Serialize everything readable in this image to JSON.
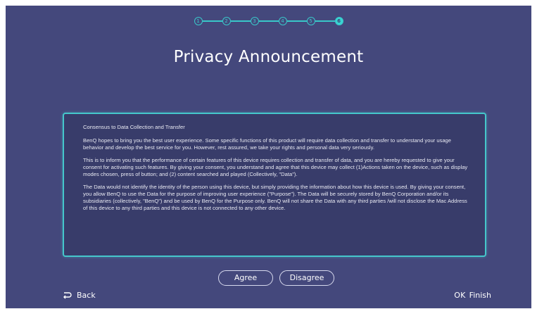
{
  "steps": [
    "1",
    "2",
    "3",
    "4",
    "5",
    "6"
  ],
  "active_step": 6,
  "title": "Privacy Announcement",
  "panel": {
    "heading": "Consensus to Data Collection and Transfer",
    "paragraphs": [
      "BenQ hopes to bring you the best user experience. Some specific functions of this product will require data collection and transfer to understand your usage behavior and develop the best service for you. However, rest assured, we take your rights and personal data very seriously.",
      "This is to inform you that the performance of certain features of this device requires collection and transfer of data, and you are hereby requested to give your consent for activating such features. By giving your consent, you understand and agree that this device may collect (1)Actions taken on the device, such as display modes chosen, press of button; and (2) content searched and played  (Collectively, \"Data\").",
      "The Data would not identify the identity of the person using this device, but simply providing the information about how this device is used.  By giving your consent, you allow BenQ to use the Data for the purpose of improving user experience (\"Purpose\").  The Data will be securely stored by BenQ Corporation and/or its subsidiaries (collectively, \"BenQ\") and be used by BenQ for the Purpose only. BenQ will not share the Data with any third parties /will not disclose the Mac Address of this device to any third parties and this device is not connected to any other device."
    ]
  },
  "buttons": {
    "agree": "Agree",
    "disagree": "Disagree"
  },
  "footer": {
    "back_label": "Back",
    "ok_key": "OK",
    "finish_label": "Finish"
  },
  "colors": {
    "background": "#44487c",
    "accent": "#39d4d2",
    "panel": "#383c6a"
  },
  "icons": {
    "back": "return-arrow-icon"
  }
}
